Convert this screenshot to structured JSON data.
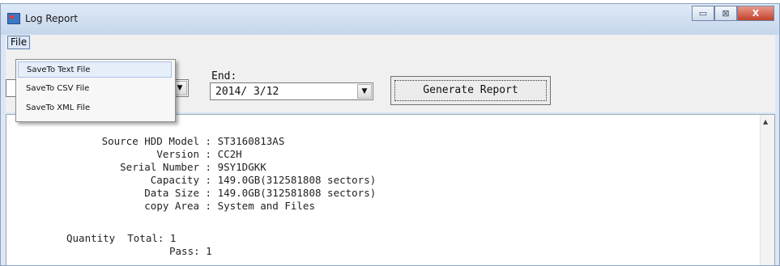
{
  "window": {
    "title": "Log Report",
    "controls": {
      "minimize": "▭",
      "maximize": "⊠",
      "close": "X"
    }
  },
  "menubar": {
    "file": "File"
  },
  "file_menu": {
    "items": [
      "SaveTo Text File",
      "SaveTo CSV File",
      "SaveTo XML File"
    ]
  },
  "filters": {
    "end_label": "End:",
    "end_value": "2014/ 3/12",
    "dropdown_arrow": "▼",
    "generate_button": "Generate Report"
  },
  "report": {
    "lines": [
      {
        "label": "Source HDD Model",
        "value": "ST3160813AS"
      },
      {
        "label": "Version",
        "value": "CC2H"
      },
      {
        "label": "Serial Number",
        "value": "9SY1DGKK"
      },
      {
        "label": "Capacity",
        "value": "149.0GB(312581808 sectors)"
      },
      {
        "label": "Data Size",
        "value": "149.0GB(312581808 sectors)"
      },
      {
        "label": "copy Area",
        "value": "System and Files"
      }
    ],
    "quantity_total": "Quantity  Total: 1",
    "pass": "Pass: 1"
  }
}
